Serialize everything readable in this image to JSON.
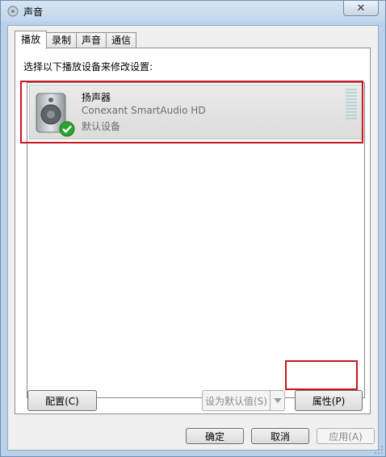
{
  "window": {
    "title": "声音",
    "close_label": "✕"
  },
  "tabs": [
    {
      "label": "播放",
      "active": true
    },
    {
      "label": "录制",
      "active": false
    },
    {
      "label": "声音",
      "active": false
    },
    {
      "label": "通信",
      "active": false
    }
  ],
  "playback": {
    "instruction": "选择以下播放设备来修改设置:",
    "devices": [
      {
        "name": "扬声器",
        "driver": "Conexant SmartAudio HD",
        "status": "默认设备",
        "icon": "speaker-icon",
        "badge_icon": "green-check-icon"
      }
    ]
  },
  "buttons": {
    "configure": "配置(C)",
    "set_default": "设为默认值(S)",
    "properties": "属性(P)",
    "ok": "确定",
    "cancel": "取消",
    "apply": "应用(A)"
  },
  "colors": {
    "highlight": "#c8161e",
    "check_green": "#2aa52a",
    "level_meter": "#b8d4d6"
  }
}
